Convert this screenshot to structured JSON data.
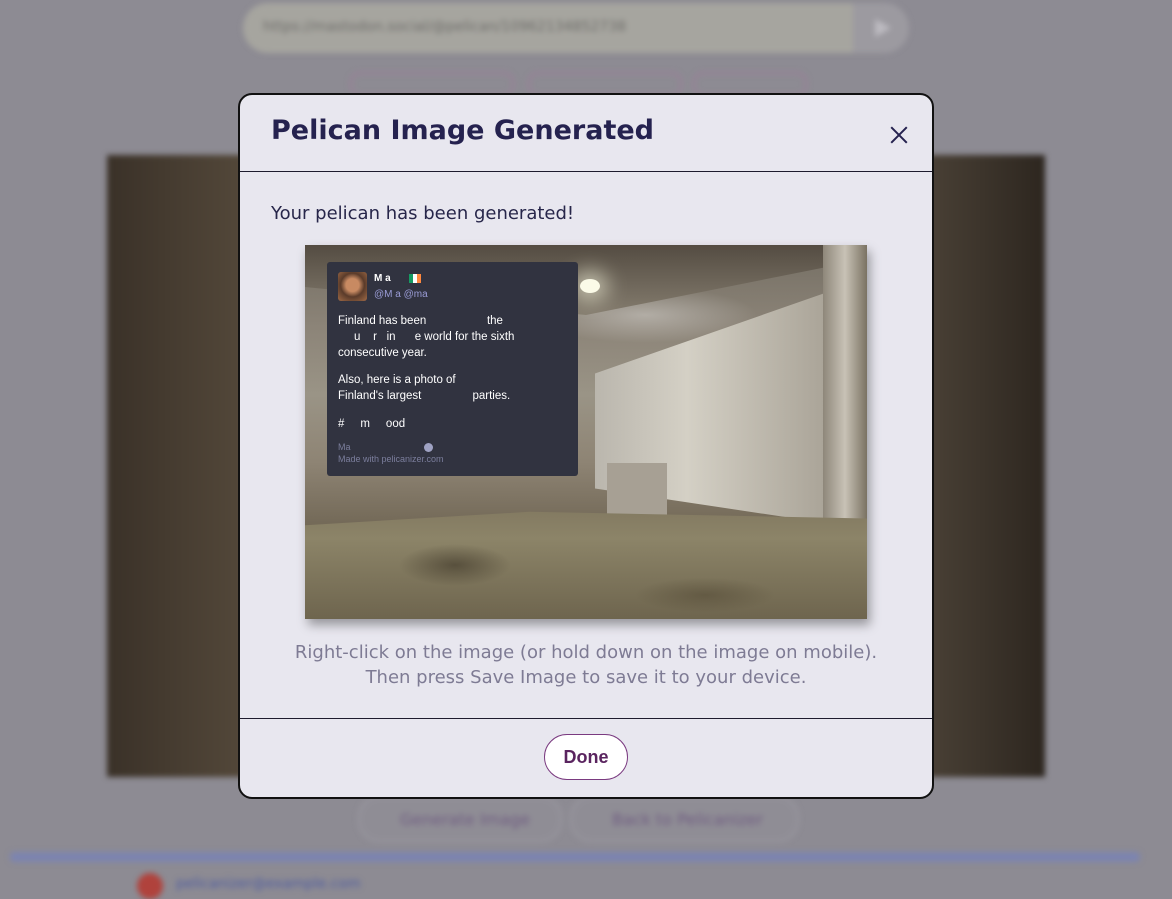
{
  "background": {
    "url_text": "https://mastodon.social/@pelican/10962134852738",
    "pill_labels": [
      "",
      "",
      ""
    ],
    "buttons": [
      {
        "label": "Generate Image"
      },
      {
        "label": "Back to Pelicanizer"
      }
    ],
    "footer_link": "pelicanizer@example.com"
  },
  "modal": {
    "title": "Pelican Image Generated",
    "close_icon": "close-icon",
    "message": "Your pelican has been generated!",
    "help_line1": "Right-click on the image (or hold down on the image on mobile).",
    "help_line2": "Then press Save Image to save it to your device.",
    "done_label": "Done"
  },
  "tweet": {
    "name": "M   a",
    "handle": "@M    a       @ma",
    "paragraph1": "Finland has been                   the\n     u    r   in      e world for the sixth\nconsecutive year.",
    "paragraph2": "Also, here is a photo of\nFinland's largest                parties.",
    "paragraph3": "#     m     ood",
    "meta": "Ma",
    "credit": "Made with pelicanizer.com",
    "flag_colors": [
      "#169b62",
      "#ffffff",
      "#ff883e"
    ]
  },
  "colors": {
    "title": "#25224f",
    "accent": "#7a3a80",
    "tweet_bg": "#313340"
  }
}
